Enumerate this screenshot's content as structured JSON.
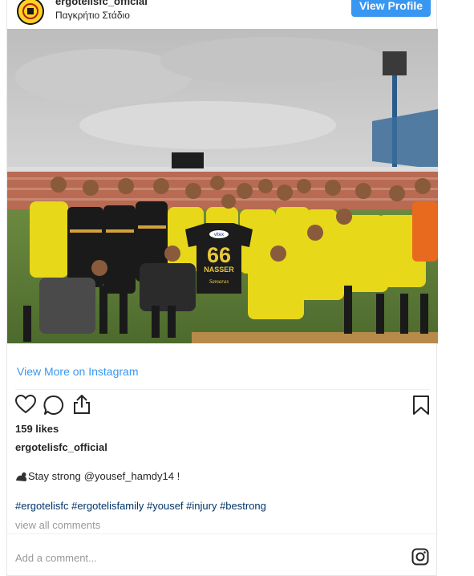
{
  "header": {
    "username": "ergotelisfc_official",
    "location": "Παγκρήτιο Στάδιο",
    "view_profile_label": "View Profile"
  },
  "photo": {
    "shirt_number": "66",
    "shirt_name": "NASSER",
    "shirt_sponsor_top": "vitex",
    "shirt_sponsor_bottom": "Samaras"
  },
  "footer": {
    "view_more_label": "View More on Instagram",
    "likes": "159 likes",
    "caption_username": "ergotelisfc_official",
    "caption_text": "Stay strong",
    "caption_mention": "@yousef_hamdy14 !",
    "hashtags": "#ergotelisfc #ergotelisfamily #yousef #injury #bestrong",
    "view_comments_label": "view all comments",
    "add_comment_label": "Add a comment..."
  },
  "colors": {
    "accent": "#3897f0",
    "hashtag": "#003569",
    "muted": "#999999",
    "jacket_yellow": "#f0dc1c",
    "grass": "#5a7a36"
  },
  "icons": [
    "heart-icon",
    "comment-icon",
    "share-icon",
    "bookmark-icon",
    "instagram-icon",
    "flexed-biceps-icon"
  ]
}
